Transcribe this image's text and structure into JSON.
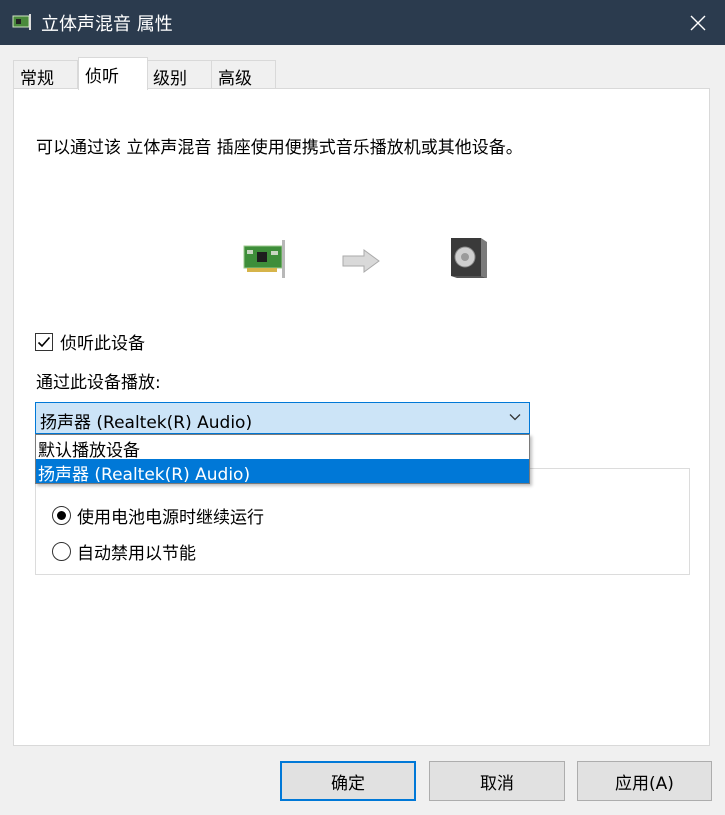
{
  "window": {
    "title": "立体声混音 属性"
  },
  "tabs": [
    "常规",
    "侦听",
    "级别",
    "高级"
  ],
  "listen": {
    "description": "可以通过该 立体声混音 插座使用便携式音乐播放机或其他设备。",
    "checkbox_label": "侦听此设备",
    "checkbox_checked": true,
    "playback_label": "通过此设备播放:",
    "playback_selected": "扬声器 (Realtek(R) Audio)",
    "playback_options": [
      "默认播放设备",
      "扬声器 (Realtek(R) Audio)"
    ],
    "highlighted_option": 1
  },
  "power": {
    "options": [
      "使用电池电源时继续运行",
      "自动禁用以节能"
    ],
    "selected": 0
  },
  "buttons": {
    "ok": "确定",
    "cancel": "取消",
    "apply": "应用(A)"
  },
  "icons": [
    "sound-card-icon",
    "arrow-right-icon",
    "speaker-icon",
    "close-icon",
    "chevron-down-icon",
    "checkmark-icon"
  ],
  "colors": {
    "titlebar": "#2b3b4e",
    "accent": "#0078d7",
    "dropdown_bg": "#cce4f7"
  }
}
